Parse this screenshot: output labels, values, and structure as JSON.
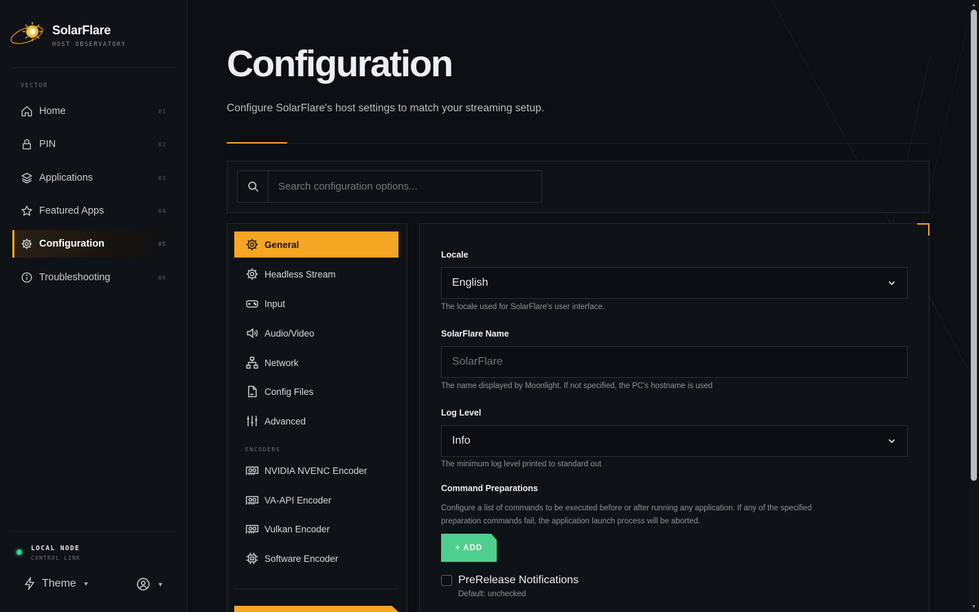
{
  "brand": {
    "name": "SolarFlare",
    "subtitle": "HOST OBSERVATORY"
  },
  "sidebar": {
    "section_label": "VECTOR",
    "items": [
      {
        "label": "Home",
        "num": "01",
        "icon": "home-icon"
      },
      {
        "label": "PIN",
        "num": "02",
        "icon": "lock-icon"
      },
      {
        "label": "Applications",
        "num": "03",
        "icon": "layers-icon"
      },
      {
        "label": "Featured Apps",
        "num": "04",
        "icon": "star-icon"
      },
      {
        "label": "Configuration",
        "num": "05",
        "icon": "gear-icon",
        "active": true
      },
      {
        "label": "Troubleshooting",
        "num": "06",
        "icon": "info-icon"
      }
    ],
    "node": {
      "title": "LOCAL NODE",
      "subtitle": "CONTROL LINK",
      "status_color": "#34d399"
    },
    "theme_label": "Theme"
  },
  "page": {
    "title": "Configuration",
    "subtitle": "Configure SolarFlare's host settings to match your streaming setup."
  },
  "search": {
    "placeholder": "Search configuration options..."
  },
  "categories": {
    "items": [
      {
        "label": "General",
        "icon": "gear-icon",
        "active": true
      },
      {
        "label": "Headless Stream",
        "icon": "gear-icon"
      },
      {
        "label": "Input",
        "icon": "gamepad-icon"
      },
      {
        "label": "Audio/Video",
        "icon": "speaker-icon"
      },
      {
        "label": "Network",
        "icon": "network-icon"
      },
      {
        "label": "Config Files",
        "icon": "file-icon"
      },
      {
        "label": "Advanced",
        "icon": "sliders-icon"
      }
    ],
    "encoders_label": "ENCODERS",
    "encoders": [
      {
        "label": "NVIDIA NVENC Encoder",
        "icon": "gpu-icon"
      },
      {
        "label": "VA-API Encoder",
        "icon": "gpu-icon"
      },
      {
        "label": "Vulkan Encoder",
        "icon": "gpu-icon"
      },
      {
        "label": "Software Encoder",
        "icon": "cpu-icon"
      }
    ]
  },
  "settings": {
    "locale": {
      "label": "Locale",
      "value": "English",
      "help": "The locale used for SolarFlare's user interface."
    },
    "name": {
      "label": "SolarFlare Name",
      "placeholder": "SolarFlare",
      "help": "The name displayed by Moonlight. If not specified, the PC's hostname is used"
    },
    "log_level": {
      "label": "Log Level",
      "value": "Info",
      "help": "The minimum log level printed to standard out"
    },
    "command_preps": {
      "label": "Command Preparations",
      "help": "Configure a list of commands to be executed before or after running any application. If any of the specified preparation commands fail, the application launch process will be aborted.",
      "add_label": "+ ADD"
    },
    "prerelease": {
      "label": "PreRelease Notifications",
      "default": "Default: unchecked"
    }
  },
  "colors": {
    "accent": "#f5a623",
    "success": "#4ecf8f",
    "background": "#0c0f13"
  }
}
